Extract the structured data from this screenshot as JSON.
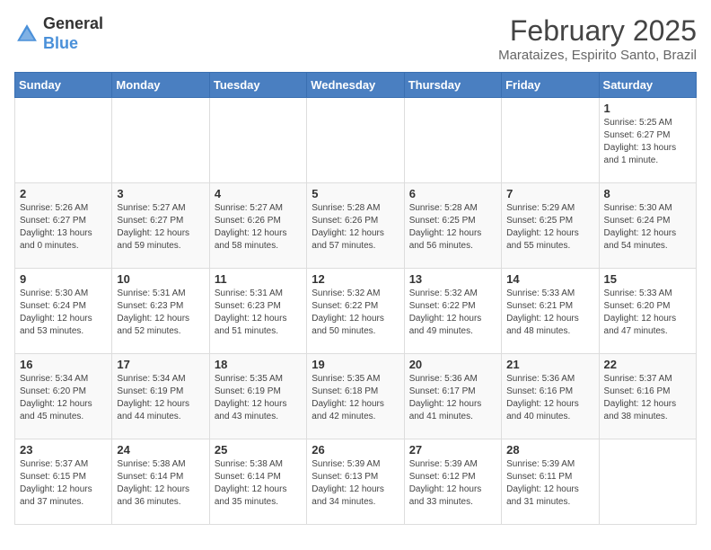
{
  "header": {
    "logo_general": "General",
    "logo_blue": "Blue",
    "month_year": "February 2025",
    "location": "Marataizes, Espirito Santo, Brazil"
  },
  "days_of_week": [
    "Sunday",
    "Monday",
    "Tuesday",
    "Wednesday",
    "Thursday",
    "Friday",
    "Saturday"
  ],
  "weeks": [
    [
      {
        "day": "",
        "info": ""
      },
      {
        "day": "",
        "info": ""
      },
      {
        "day": "",
        "info": ""
      },
      {
        "day": "",
        "info": ""
      },
      {
        "day": "",
        "info": ""
      },
      {
        "day": "",
        "info": ""
      },
      {
        "day": "1",
        "info": "Sunrise: 5:25 AM\nSunset: 6:27 PM\nDaylight: 13 hours and 1 minute."
      }
    ],
    [
      {
        "day": "2",
        "info": "Sunrise: 5:26 AM\nSunset: 6:27 PM\nDaylight: 13 hours and 0 minutes."
      },
      {
        "day": "3",
        "info": "Sunrise: 5:27 AM\nSunset: 6:27 PM\nDaylight: 12 hours and 59 minutes."
      },
      {
        "day": "4",
        "info": "Sunrise: 5:27 AM\nSunset: 6:26 PM\nDaylight: 12 hours and 58 minutes."
      },
      {
        "day": "5",
        "info": "Sunrise: 5:28 AM\nSunset: 6:26 PM\nDaylight: 12 hours and 57 minutes."
      },
      {
        "day": "6",
        "info": "Sunrise: 5:28 AM\nSunset: 6:25 PM\nDaylight: 12 hours and 56 minutes."
      },
      {
        "day": "7",
        "info": "Sunrise: 5:29 AM\nSunset: 6:25 PM\nDaylight: 12 hours and 55 minutes."
      },
      {
        "day": "8",
        "info": "Sunrise: 5:30 AM\nSunset: 6:24 PM\nDaylight: 12 hours and 54 minutes."
      }
    ],
    [
      {
        "day": "9",
        "info": "Sunrise: 5:30 AM\nSunset: 6:24 PM\nDaylight: 12 hours and 53 minutes."
      },
      {
        "day": "10",
        "info": "Sunrise: 5:31 AM\nSunset: 6:23 PM\nDaylight: 12 hours and 52 minutes."
      },
      {
        "day": "11",
        "info": "Sunrise: 5:31 AM\nSunset: 6:23 PM\nDaylight: 12 hours and 51 minutes."
      },
      {
        "day": "12",
        "info": "Sunrise: 5:32 AM\nSunset: 6:22 PM\nDaylight: 12 hours and 50 minutes."
      },
      {
        "day": "13",
        "info": "Sunrise: 5:32 AM\nSunset: 6:22 PM\nDaylight: 12 hours and 49 minutes."
      },
      {
        "day": "14",
        "info": "Sunrise: 5:33 AM\nSunset: 6:21 PM\nDaylight: 12 hours and 48 minutes."
      },
      {
        "day": "15",
        "info": "Sunrise: 5:33 AM\nSunset: 6:20 PM\nDaylight: 12 hours and 47 minutes."
      }
    ],
    [
      {
        "day": "16",
        "info": "Sunrise: 5:34 AM\nSunset: 6:20 PM\nDaylight: 12 hours and 45 minutes."
      },
      {
        "day": "17",
        "info": "Sunrise: 5:34 AM\nSunset: 6:19 PM\nDaylight: 12 hours and 44 minutes."
      },
      {
        "day": "18",
        "info": "Sunrise: 5:35 AM\nSunset: 6:19 PM\nDaylight: 12 hours and 43 minutes."
      },
      {
        "day": "19",
        "info": "Sunrise: 5:35 AM\nSunset: 6:18 PM\nDaylight: 12 hours and 42 minutes."
      },
      {
        "day": "20",
        "info": "Sunrise: 5:36 AM\nSunset: 6:17 PM\nDaylight: 12 hours and 41 minutes."
      },
      {
        "day": "21",
        "info": "Sunrise: 5:36 AM\nSunset: 6:16 PM\nDaylight: 12 hours and 40 minutes."
      },
      {
        "day": "22",
        "info": "Sunrise: 5:37 AM\nSunset: 6:16 PM\nDaylight: 12 hours and 38 minutes."
      }
    ],
    [
      {
        "day": "23",
        "info": "Sunrise: 5:37 AM\nSunset: 6:15 PM\nDaylight: 12 hours and 37 minutes."
      },
      {
        "day": "24",
        "info": "Sunrise: 5:38 AM\nSunset: 6:14 PM\nDaylight: 12 hours and 36 minutes."
      },
      {
        "day": "25",
        "info": "Sunrise: 5:38 AM\nSunset: 6:14 PM\nDaylight: 12 hours and 35 minutes."
      },
      {
        "day": "26",
        "info": "Sunrise: 5:39 AM\nSunset: 6:13 PM\nDaylight: 12 hours and 34 minutes."
      },
      {
        "day": "27",
        "info": "Sunrise: 5:39 AM\nSunset: 6:12 PM\nDaylight: 12 hours and 33 minutes."
      },
      {
        "day": "28",
        "info": "Sunrise: 5:39 AM\nSunset: 6:11 PM\nDaylight: 12 hours and 31 minutes."
      },
      {
        "day": "",
        "info": ""
      }
    ]
  ]
}
